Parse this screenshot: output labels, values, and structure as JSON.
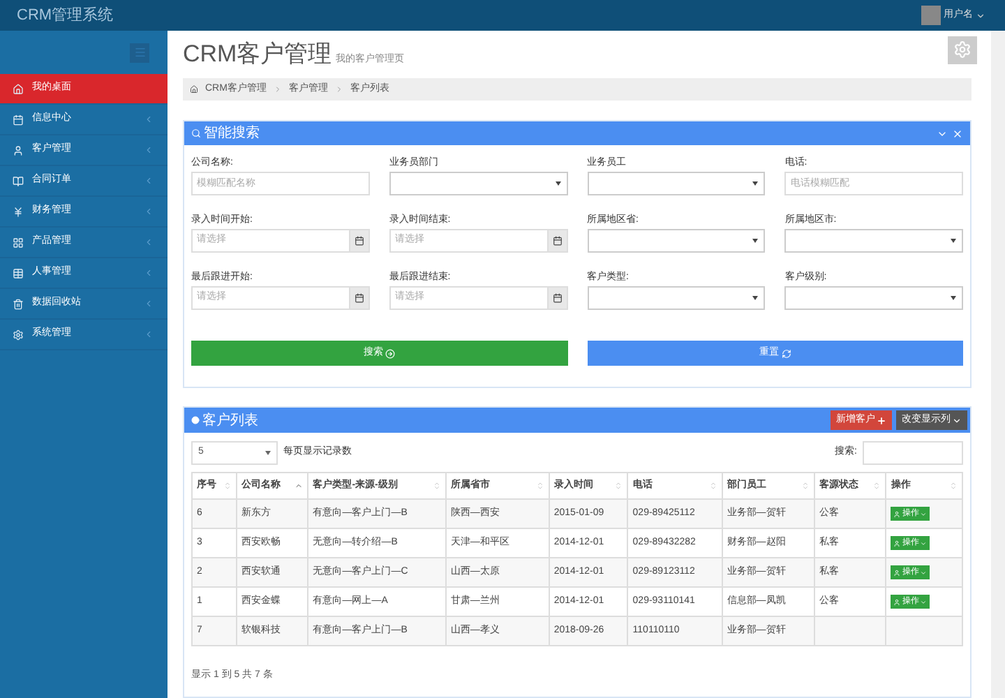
{
  "app_title": "CRM管理系统",
  "user": {
    "name": "用户名"
  },
  "sidebar": {
    "items": [
      {
        "label": "我的桌面",
        "selected": true,
        "expandable": false
      },
      {
        "label": "信息中心",
        "selected": false,
        "expandable": true
      },
      {
        "label": "客户管理",
        "selected": false,
        "expandable": true
      },
      {
        "label": "合同订单",
        "selected": false,
        "expandable": true
      },
      {
        "label": "财务管理",
        "selected": false,
        "expandable": true
      },
      {
        "label": "产品管理",
        "selected": false,
        "expandable": true
      },
      {
        "label": "人事管理",
        "selected": false,
        "expandable": true
      },
      {
        "label": "数据回收站",
        "selected": false,
        "expandable": true
      },
      {
        "label": "系统管理",
        "selected": false,
        "expandable": true
      }
    ]
  },
  "page": {
    "title": "CRM客户管理",
    "subtitle": "我的客户管理页"
  },
  "breadcrumb": [
    "CRM客户管理",
    "客户管理",
    "客户列表"
  ],
  "search_panel": {
    "title": "智能搜索",
    "fields": [
      {
        "label": "公司名称:",
        "kind": "text",
        "placeholder": "模糊匹配名称"
      },
      {
        "label": "业务员部门",
        "kind": "select"
      },
      {
        "label": "业务员工",
        "kind": "select"
      },
      {
        "label": "电话:",
        "kind": "text",
        "placeholder": "电话模糊匹配"
      },
      {
        "label": "录入时间开始:",
        "kind": "date",
        "placeholder": "请选择"
      },
      {
        "label": "录入时间结束:",
        "kind": "date",
        "placeholder": "请选择"
      },
      {
        "label": "所属地区省:",
        "kind": "select"
      },
      {
        "label": "所属地区市:",
        "kind": "select"
      },
      {
        "label": "最后跟进开始:",
        "kind": "date",
        "placeholder": "请选择"
      },
      {
        "label": "最后跟进结束:",
        "kind": "date",
        "placeholder": "请选择"
      },
      {
        "label": "客户类型:",
        "kind": "select"
      },
      {
        "label": "客户级别:",
        "kind": "select"
      }
    ],
    "buttons": [
      {
        "label": "搜索",
        "kind": "search"
      },
      {
        "label": "重置",
        "kind": "reset"
      }
    ]
  },
  "list_panel": {
    "title": "客户列表",
    "buttons": [
      {
        "label": "新增客户",
        "kind": "add"
      },
      {
        "label": "改变显示列",
        "kind": "columns"
      }
    ],
    "page_size": "5",
    "page_size_label": "每页显示记录数",
    "search_label": "搜索:",
    "table": {
      "columns": [
        {
          "label": "序号",
          "sorted": false
        },
        {
          "label": "公司名称",
          "sorted": true
        },
        {
          "label": "客户类型-来源-级别",
          "sorted": false
        },
        {
          "label": "所属省市",
          "sorted": false
        },
        {
          "label": "录入时间",
          "sorted": false
        },
        {
          "label": "电话",
          "sorted": false
        },
        {
          "label": "部门员工",
          "sorted": false
        },
        {
          "label": "客源状态",
          "sorted": false
        },
        {
          "label": "操作",
          "sorted": false
        }
      ],
      "rows": [
        {
          "cells": [
            "6",
            "新东方",
            "有意向—客户上门—B",
            "陕西—西安",
            "2015-01-09",
            "029-89425112",
            "业务部—贺轩",
            "公客"
          ],
          "action": "操作"
        },
        {
          "cells": [
            "3",
            "西安欧畅",
            "无意向—转介绍—B",
            "天津—和平区",
            "2014-12-01",
            "029-89432282",
            "财务部—赵阳",
            "私客"
          ],
          "action": "操作"
        },
        {
          "cells": [
            "2",
            "西安软通",
            "无意向—客户上门—C",
            "山西—太原",
            "2014-12-01",
            "029-89123112",
            "业务部—贺轩",
            "私客"
          ],
          "action": "操作"
        },
        {
          "cells": [
            "1",
            "西安金蝶",
            "有意向—网上—A",
            "甘肃—兰州",
            "2014-12-01",
            "029-93110141",
            "信息部—凤凯",
            "公客"
          ],
          "action": "操作"
        },
        {
          "cells": [
            "7",
            "软银科技",
            "有意向—客户上门—B",
            "山西—孝义",
            "2018-09-26",
            "110110110",
            "业务部—贺轩"
          ]
        }
      ]
    },
    "footer": "显示 1 到 5 共 7 条"
  }
}
